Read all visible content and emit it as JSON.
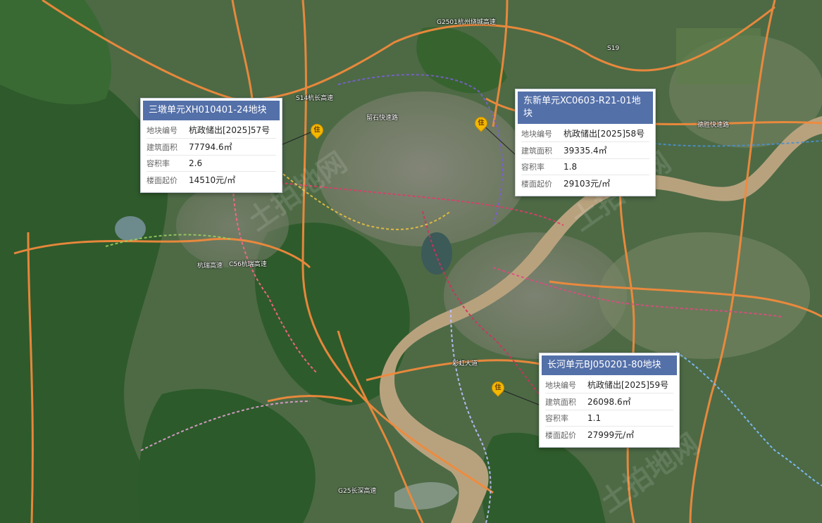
{
  "colors": {
    "title_bg": "#5470a9",
    "road_orange": "#f08a3c",
    "river": "#b8a27e",
    "pin": "#f5b800"
  },
  "pin_glyph": "住",
  "watermark": "土拍地网",
  "parcels": [
    {
      "title": "三墩单元XH010401-24地块",
      "rows": [
        {
          "key": "地块编号",
          "value": "杭政储出[2025]57号"
        },
        {
          "key": "建筑面积",
          "value": "77794.6㎡"
        },
        {
          "key": "容积率",
          "value": "2.6"
        },
        {
          "key": "楼面起价",
          "value": "14510元/㎡"
        }
      ]
    },
    {
      "title": "东新单元XC0603-R21-01地块",
      "rows": [
        {
          "key": "地块编号",
          "value": "杭政储出[2025]58号"
        },
        {
          "key": "建筑面积",
          "value": "39335.4㎡"
        },
        {
          "key": "容积率",
          "value": "1.8"
        },
        {
          "key": "楼面起价",
          "value": "29103元/㎡"
        }
      ]
    },
    {
      "title": "长河单元BJ050201-80地块",
      "rows": [
        {
          "key": "地块编号",
          "value": "杭政储出[2025]59号"
        },
        {
          "key": "建筑面积",
          "value": "26098.6㎡"
        },
        {
          "key": "容积率",
          "value": "1.1"
        },
        {
          "key": "楼面起价",
          "value": "27999元/㎡"
        }
      ]
    }
  ],
  "road_labels": [
    "S14杭长高速",
    "G2501杭州绕城高速",
    "德胜快速路",
    "留石快速路",
    "C56杭瑞高速",
    "G25长深高速",
    "彩虹大道",
    "杭瑞高速",
    "S19"
  ]
}
